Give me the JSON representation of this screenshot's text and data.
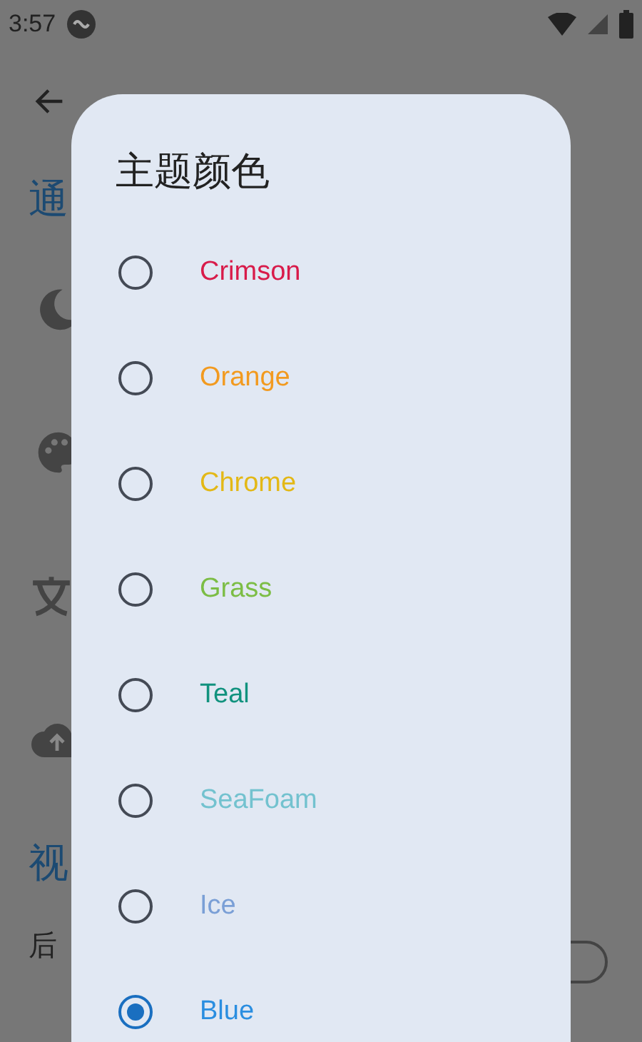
{
  "status_bar": {
    "time": "3:57"
  },
  "settings_page": {
    "section_1": "通",
    "section_2": "视",
    "row_label": "后",
    "toggle_on": false
  },
  "dialog": {
    "title": "主题颜色",
    "options": [
      {
        "label": "Crimson",
        "color": "#d81b4a",
        "selected": false
      },
      {
        "label": "Orange",
        "color": "#f29a1f",
        "selected": false
      },
      {
        "label": "Chrome",
        "color": "#e3b816",
        "selected": false
      },
      {
        "label": "Grass",
        "color": "#7cbd45",
        "selected": false
      },
      {
        "label": "Teal",
        "color": "#11927e",
        "selected": false
      },
      {
        "label": "SeaFoam",
        "color": "#73c2cf",
        "selected": false
      },
      {
        "label": "Ice",
        "color": "#7a9fd6",
        "selected": false
      },
      {
        "label": "Blue",
        "color": "#2a8ee0",
        "selected": true
      }
    ]
  }
}
